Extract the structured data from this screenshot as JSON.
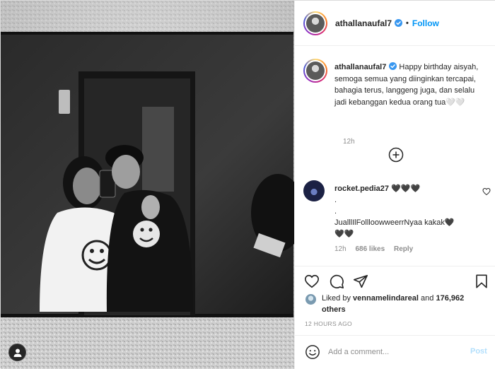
{
  "post": {
    "username": "athallanaufal7",
    "follow_label": "Follow",
    "separator": "•",
    "caption_text": "Happy birthday aisyah, semoga semua yang diinginkan tercapai, bahagia terus, langgeng juga, dan selalu jadi kebanggan kedua orang tua🤍🤍",
    "caption_time": "12h",
    "posted_ago": "12 HOURS AGO"
  },
  "comments": [
    {
      "username": "rocket.pedia27",
      "text": "🖤🖤🖤\n.\n.\nJualllIlFollloowweerrNyaa kakak🖤\n🖤🖤",
      "time": "12h",
      "likes": "686 likes",
      "reply_label": "Reply"
    }
  ],
  "likes": {
    "prefix": "Liked by",
    "username": "vennamelindareal",
    "and": "and",
    "count": "176,962 others"
  },
  "add_comment": {
    "placeholder": "Add a comment...",
    "post_label": "Post"
  },
  "icons": {
    "verified": "verified-badge-icon",
    "load_more": "plus-circle-icon",
    "heart": "heart-icon",
    "comment": "comment-icon",
    "share": "paper-plane-icon",
    "save": "bookmark-icon",
    "emoji": "smiley-icon",
    "user_tag": "user-icon"
  },
  "colors": {
    "follow_blue": "#0095f6",
    "verified_blue": "#3897f0",
    "muted": "#8e8e8e",
    "post_disabled": "#b2dffc"
  }
}
